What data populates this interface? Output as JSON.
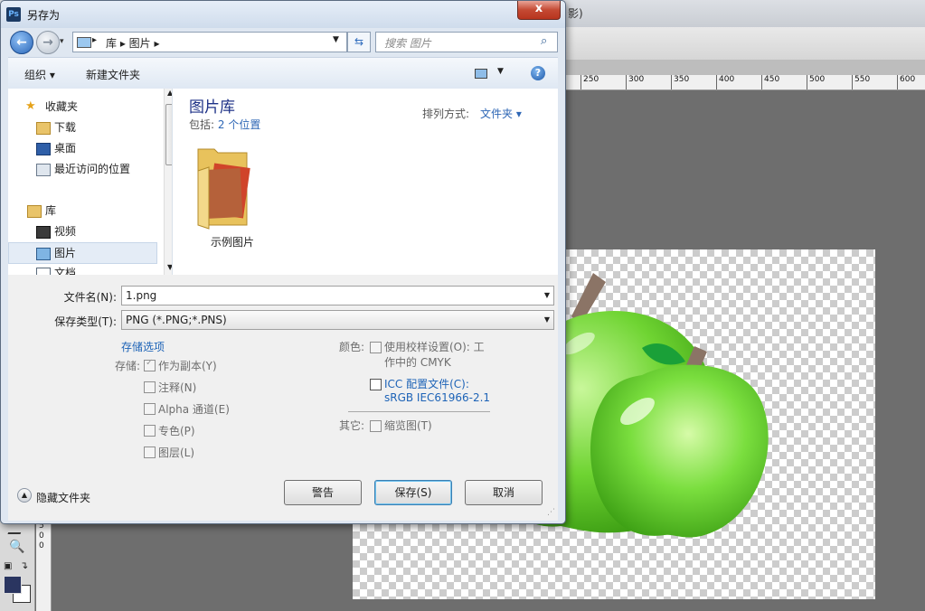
{
  "photoshop": {
    "title_fragment": "影)",
    "ruler_ticks": [
      "250",
      "300",
      "350",
      "400",
      "450",
      "500",
      "550",
      "600"
    ],
    "vruler_digits": [
      "5",
      "0",
      "0"
    ]
  },
  "dialog": {
    "title": "另存为",
    "app_badge": "Ps",
    "close_glyph": "x",
    "address": "库 ▸ 图片 ▸",
    "address_prefix": "▸",
    "search_placeholder": "搜索 图片",
    "toolbar": {
      "organize": "组织 ▾",
      "new_folder": "新建文件夹"
    },
    "nav": {
      "favorites": "收藏夹",
      "downloads": "下载",
      "desktop": "桌面",
      "recent": "最近访问的位置",
      "libraries": "库",
      "videos": "视频",
      "pictures": "图片",
      "documents": "文档"
    },
    "library": {
      "title": "图片库",
      "include_label": "包括:",
      "include_count": "2 个位置",
      "arrange_label": "排列方式:",
      "arrange_value": "文件夹 ▾",
      "folder_name": "示例图片"
    },
    "form": {
      "filename_label": "文件名(N):",
      "filename_value": "1.png",
      "type_label": "保存类型(T):",
      "type_value": "PNG (*.PNG;*.PNS)",
      "save_options": "存储选项",
      "save_label": "存储:",
      "as_copy": "作为副本(Y)",
      "notes": "注释(N)",
      "alpha": "Alpha 通道(E)",
      "spot": "专色(P)",
      "layers": "图层(L)",
      "color_label": "颜色:",
      "proof_line1": "使用校样设置(O):  工",
      "proof_line2": "作中的 CMYK",
      "icc_line1": "ICC 配置文件(C):",
      "icc_line2": "sRGB IEC61966-2.1",
      "other_label": "其它:",
      "thumbnail": "缩览图(T)"
    },
    "buttons": {
      "hide_folders": "隐藏文件夹",
      "warning": "警告",
      "save": "保存(S)",
      "cancel": "取消"
    }
  }
}
